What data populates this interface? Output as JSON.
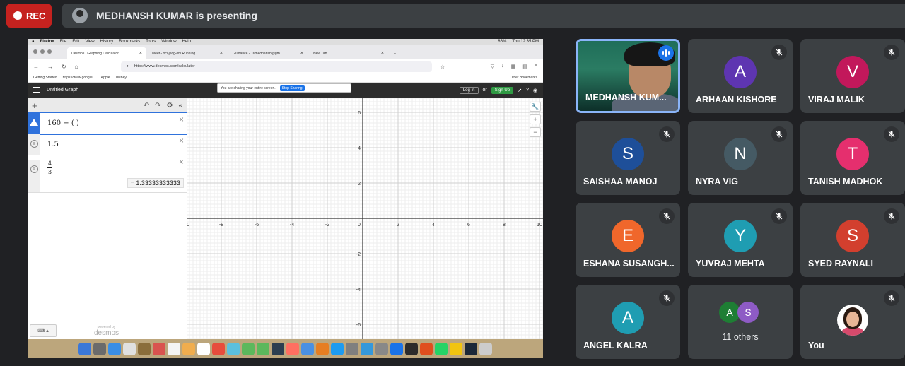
{
  "rec": {
    "label": "REC"
  },
  "presenting": {
    "text": "MEDHANSH KUMAR is presenting"
  },
  "screen": {
    "menubar": {
      "items": [
        "Firefox",
        "File",
        "Edit",
        "View",
        "History",
        "Bookmarks",
        "Tools",
        "Window",
        "Help"
      ],
      "battery": "86%",
      "clock": "Thu 12:35 PM"
    },
    "tabs": [
      {
        "label": "Desmos | Graphing Calculator"
      },
      {
        "label": "Meet - ocl-jecg-otv Running"
      },
      {
        "label": "Guidance - 16medhansh@gm..."
      },
      {
        "label": "New Tab"
      }
    ],
    "new_tab": "+",
    "url": "https://www.desmos.com/calculator",
    "bookmarks": [
      "Getting Started",
      "https://www.google...",
      "Apple",
      "Disney"
    ],
    "other_bookmarks": "Other Bookmarks",
    "desmos": {
      "title": "Untitled Graph",
      "share_text": "You are sharing your entire screen.",
      "stop_sharing": "Stop Sharing",
      "login": "Log In",
      "or": "or",
      "signup": "Sign Up",
      "expressions": [
        {
          "text": "160 − ( )"
        },
        {
          "text": "1.5"
        },
        {
          "num": "4",
          "den": "3",
          "result": "= 1.33333333333"
        }
      ],
      "powered_by": "powered by",
      "brand": "desmos",
      "x_ticks": [
        "-10",
        "-8",
        "-6",
        "-4",
        "-2",
        "0",
        "2",
        "4",
        "6",
        "8",
        "10"
      ],
      "y_ticks": [
        "6",
        "4",
        "2",
        "-2",
        "-4",
        "-6"
      ]
    }
  },
  "participants": [
    {
      "name": "MEDHANSH KUM...",
      "type": "video"
    },
    {
      "name": "ARHAAN KISHORE",
      "initial": "A",
      "color": "#5e35b1"
    },
    {
      "name": "VIRAJ MALIK",
      "initial": "V",
      "color": "#c2185b"
    },
    {
      "name": "SAISHAA MANOJ",
      "initial": "S",
      "color": "#1e4f99"
    },
    {
      "name": "NYRA VIG",
      "initial": "N",
      "color": "#455a64"
    },
    {
      "name": "TANISH MADHOK",
      "initial": "T",
      "color": "#e52f6e"
    },
    {
      "name": "ESHANA SUSANGH...",
      "initial": "E",
      "color": "#f0672b"
    },
    {
      "name": "YUVRAJ MEHTA",
      "initial": "Y",
      "color": "#1f9db2"
    },
    {
      "name": "SYED RAYNALI",
      "initial": "S",
      "color": "#d23f2e"
    },
    {
      "name": "ANGEL KALRA",
      "initial": "A",
      "color": "#1f9db2"
    },
    {
      "others_label": "11 others",
      "a": "A",
      "b": "S"
    },
    {
      "name": "You",
      "type": "self"
    }
  ]
}
